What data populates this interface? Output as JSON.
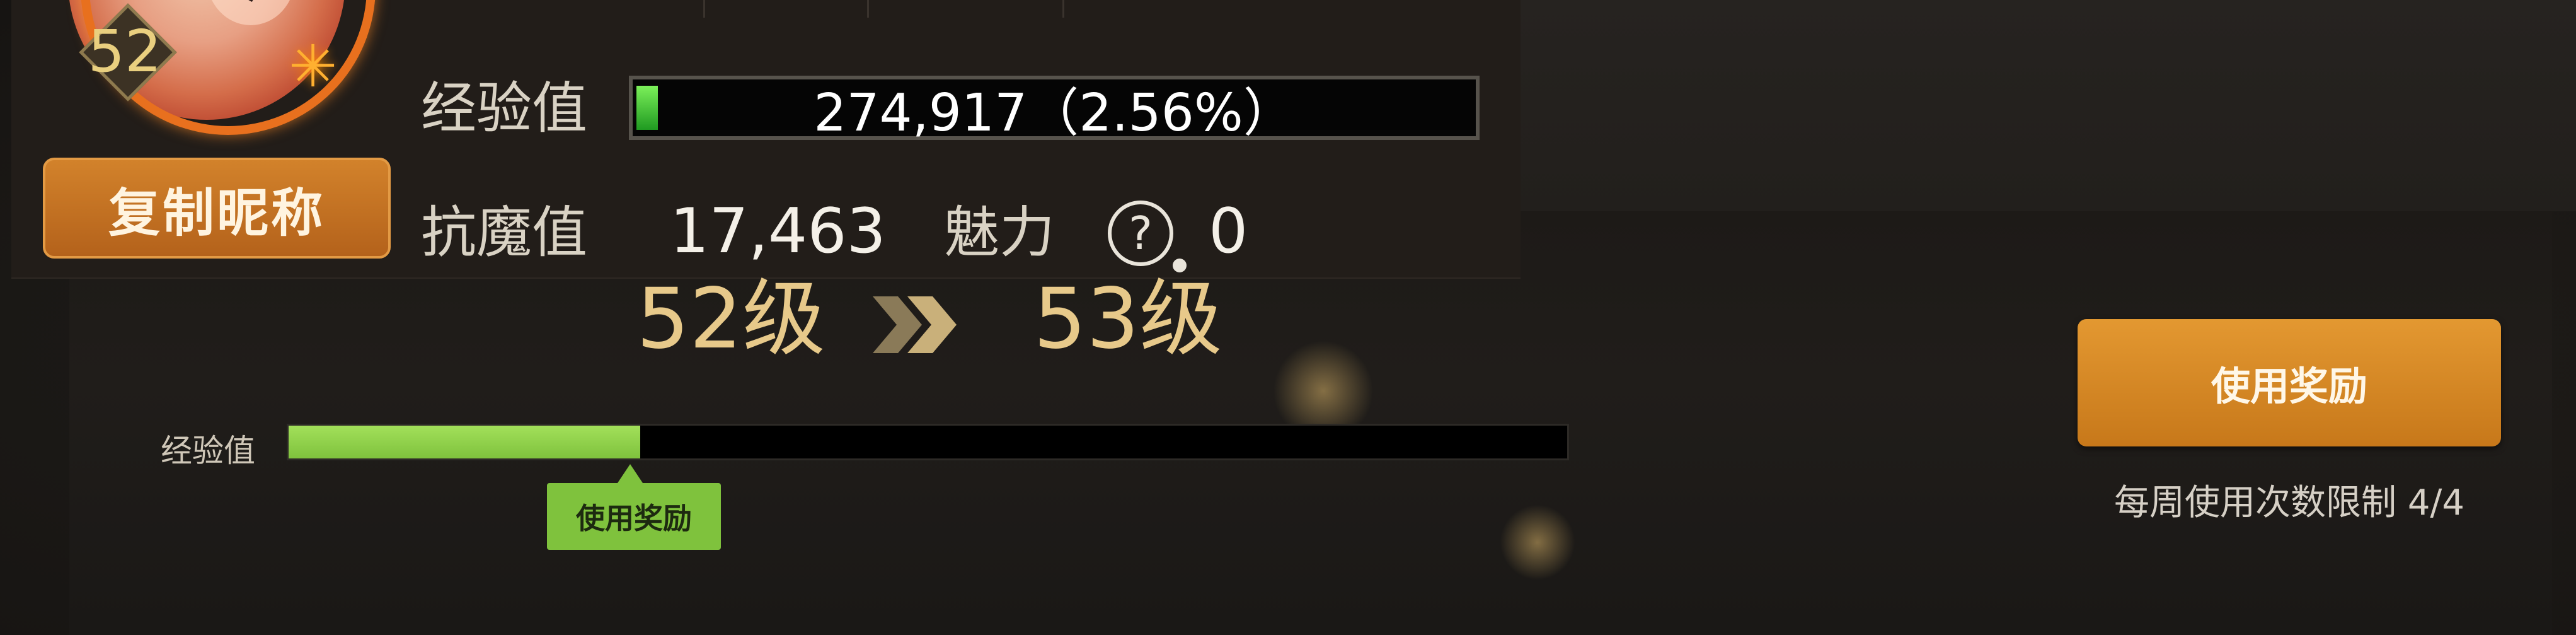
{
  "profile": {
    "level": "52",
    "copy_nickname_label": "复制昵称",
    "exp_label": "经验值",
    "exp_value": "274,917（2.56%）",
    "exp_fraction": 0.0256,
    "resist_label": "抗魔值",
    "resist_value": "17,463",
    "charm_label": "魅力",
    "charm_value": "0",
    "help_glyph": "?"
  },
  "level_up": {
    "from_level": "52级",
    "to_level": "53级"
  },
  "progress": {
    "label": "经验值",
    "fraction": 0.275,
    "tooltip": "使用奖励",
    "fill_color": "#7fc23d"
  },
  "reward": {
    "use_button_label": "使用奖励",
    "weekly_limit": "每周使用次数限制 4/4"
  },
  "colors": {
    "accent_orange": "#c7781a",
    "gold_text": "#e7c98a",
    "exp_green": "#1f9a21"
  },
  "icons": {
    "help": "help-icon",
    "arrow": "double-chevron-right-icon"
  }
}
